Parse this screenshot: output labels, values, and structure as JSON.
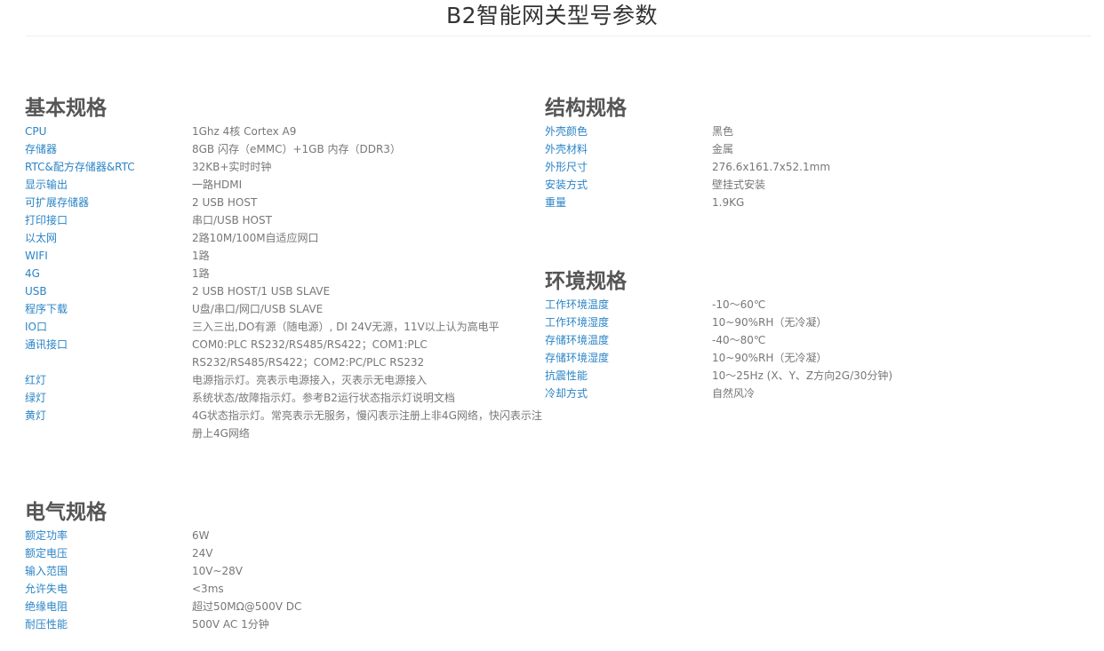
{
  "page": {
    "title": "B2智能网关型号参数"
  },
  "sections": {
    "basic": {
      "heading": "基本规格",
      "rows": [
        {
          "label": "CPU",
          "value": "1Ghz 4核 Cortex A9"
        },
        {
          "label": "存储器",
          "value": "8GB 闪存（eMMC）+1GB 内存（DDR3）"
        },
        {
          "label": "RTC&配方存储器&RTC",
          "value": "32KB+实时时钟"
        },
        {
          "label": "显示输出",
          "value": "一路HDMI"
        },
        {
          "label": "可扩展存储器",
          "value": "2 USB HOST"
        },
        {
          "label": "打印接口",
          "value": "串口/USB HOST"
        },
        {
          "label": "以太网",
          "value": "2路10M/100M自适应网口"
        },
        {
          "label": "WIFI",
          "value": "1路"
        },
        {
          "label": "4G",
          "value": "1路"
        },
        {
          "label": "USB",
          "value": "2 USB HOST/1 USB SLAVE"
        },
        {
          "label": "程序下载",
          "value": "U盘/串口/网口/USB SLAVE"
        },
        {
          "label": "IO口",
          "value": "三入三出,DO有源（随电源）, DI 24V无源，11V以上认为高电平"
        },
        {
          "label": "通讯接口",
          "value": "COM0:PLC RS232/RS485/RS422；COM1:PLC RS232/RS485/RS422；COM2:PC/PLC RS232"
        },
        {
          "label": "红灯",
          "value": "电源指示灯。亮表示电源接入，灭表示无电源接入"
        },
        {
          "label": "绿灯",
          "value": "系统状态/故障指示灯。参考B2运行状态指示灯说明文档"
        },
        {
          "label": "黄灯",
          "value": "4G状态指示灯。常亮表示无服务，慢闪表示注册上非4G网络，快闪表示注册上4G网络"
        }
      ]
    },
    "struct": {
      "heading": "结构规格",
      "rows": [
        {
          "label": "外壳颜色",
          "value": "黑色"
        },
        {
          "label": "外壳材料",
          "value": "金属"
        },
        {
          "label": "外形尺寸",
          "value": "276.6x161.7x52.1mm"
        },
        {
          "label": "安装方式",
          "value": "壁挂式安装"
        },
        {
          "label": "重量",
          "value": "1.9KG"
        }
      ]
    },
    "env": {
      "heading": "环境规格",
      "rows": [
        {
          "label": "工作环境温度",
          "value": "-10～60℃"
        },
        {
          "label": "工作环境湿度",
          "value": "10~90%RH（无冷凝）"
        },
        {
          "label": "存储环境温度",
          "value": "-40～80℃"
        },
        {
          "label": "存储环境湿度",
          "value": "10~90%RH（无冷凝）"
        },
        {
          "label": "抗震性能",
          "value": "10～25Hz (X、Y、Z方向2G/30分钟)"
        },
        {
          "label": "冷却方式",
          "value": "自然风冷"
        }
      ]
    },
    "elec": {
      "heading": "电气规格",
      "rows": [
        {
          "label": "额定功率",
          "value": "6W"
        },
        {
          "label": "额定电压",
          "value": "24V"
        },
        {
          "label": "输入范围",
          "value": "10V~28V"
        },
        {
          "label": "允许失电",
          "value": "<3ms"
        },
        {
          "label": "绝缘电阻",
          "value": "超过50MΩ@500V DC"
        },
        {
          "label": "耐压性能",
          "value": "500V AC 1分钟"
        }
      ]
    }
  }
}
